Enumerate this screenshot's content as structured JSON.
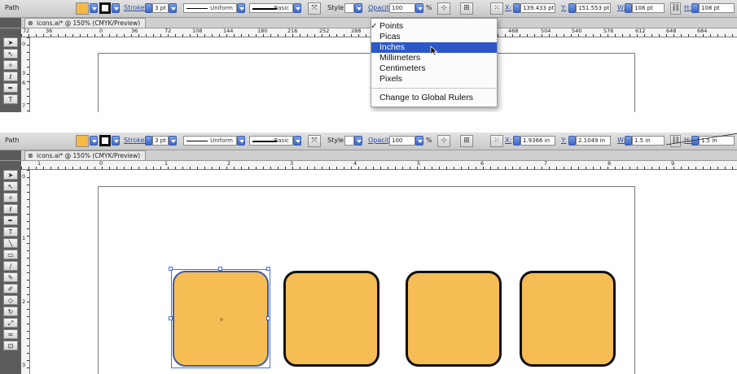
{
  "top": {
    "control_bar": {
      "object_type": "Path",
      "stroke_label": "Stroke:",
      "stroke_weight": "3 pt",
      "profile_label": "Uniform",
      "brush_label": "Basic",
      "style_label": "Style:",
      "opacity_label": "Opacity:",
      "opacity_value": "100",
      "percent": "%",
      "x_label": "X:",
      "x_value": "139.433 pt",
      "y_label": "Y:",
      "y_value": "151.553 pt",
      "w_label": "W:",
      "w_value": "108 pt",
      "h_label": "H:",
      "h_value": "108 pt"
    },
    "doc_tab": "icons.ai* @ 150% (CMYK/Preview)",
    "ruler_numbers": [
      "72",
      "36",
      "0",
      "36",
      "72",
      "108",
      "144",
      "180",
      "216",
      "252",
      "288",
      "468",
      "504",
      "540",
      "576",
      "612",
      "648",
      "684"
    ],
    "vruler_numbers": [
      "0",
      "3",
      "6",
      "7"
    ],
    "units_menu": {
      "items": [
        "Points",
        "Picas",
        "Inches",
        "Millimeters",
        "Centimeters",
        "Pixels"
      ],
      "checked": "Points",
      "highlighted": "Inches",
      "global_rulers": "Change to Global Rulers"
    }
  },
  "bottom": {
    "control_bar": {
      "object_type": "Path",
      "stroke_label": "Stroke:",
      "stroke_weight": "3 pt",
      "profile_label": "Uniform",
      "brush_label": "Basic",
      "style_label": "Style:",
      "opacity_label": "Opacity:",
      "opacity_value": "100",
      "percent": "%",
      "x_label": "X:",
      "x_value": "1.9366 in",
      "y_label": "Y:",
      "y_value": "2.1049 in",
      "w_label": "W:",
      "w_value": "1.5 in",
      "h_label": "H:",
      "h_value": "1.5 in"
    },
    "doc_tab": "icons.ai* @ 150% (CMYK/Preview)",
    "ruler_numbers": [
      "1",
      "0",
      "1",
      "2",
      "3",
      "4",
      "5",
      "6",
      "7",
      "8",
      "9"
    ],
    "vruler_numbers": [
      "0",
      "1",
      "2",
      "3"
    ]
  },
  "colors": {
    "fill": "#f6bd55",
    "stroke": "#111111",
    "menu_highlight": "#2c57c6",
    "selection": "#4a6fd0"
  },
  "tools": [
    "selection-tool",
    "direct-selection-tool",
    "magic-wand-tool",
    "lasso-tool",
    "pen-tool",
    "type-tool",
    "line-tool",
    "rectangle-tool",
    "paintbrush-tool",
    "pencil-tool",
    "blob-brush-tool",
    "eraser-tool",
    "rotate-tool",
    "scale-tool",
    "warp-tool",
    "free-transform-tool"
  ]
}
